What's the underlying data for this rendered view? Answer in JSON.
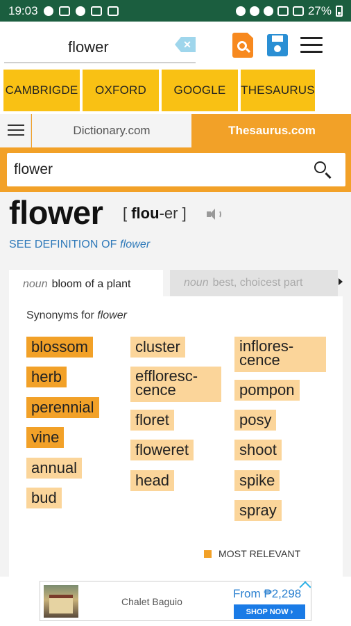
{
  "status_bar": {
    "time": "19:03",
    "battery": "27%"
  },
  "search": {
    "value": "flower"
  },
  "sources": [
    "CAMBRIGDE",
    "OXFORD",
    "GOOGLE",
    "THESAURUS"
  ],
  "site_tabs": {
    "dictionary": "Dictionary.com",
    "thesaurus": "Thesaurus.com"
  },
  "thesaurus_search": {
    "value": "flower"
  },
  "entry": {
    "headword": "flower",
    "pron_open": "[ ",
    "pron_stress": "flou",
    "pron_rest": "-er ]",
    "see_def_prefix": "SEE DEFINITION OF ",
    "see_def_word": "flower"
  },
  "sense_tabs": [
    {
      "pos": "noun",
      "label": "bloom of a plant"
    },
    {
      "pos": "noun",
      "label": "best, choicest part"
    }
  ],
  "synonyms": {
    "heading_prefix": "Synonyms for ",
    "heading_word": "flower",
    "col1": [
      {
        "word": "blossom",
        "relevance": "strong"
      },
      {
        "word": "herb",
        "relevance": "strong"
      },
      {
        "word": "perennial",
        "relevance": "strong"
      },
      {
        "word": "vine",
        "relevance": "strong"
      },
      {
        "word": "annual",
        "relevance": "weak"
      },
      {
        "word": "bud",
        "relevance": "weak"
      }
    ],
    "col2": [
      {
        "word": "cluster",
        "relevance": "weak"
      },
      {
        "word": "effloresence",
        "relevance": "weak",
        "line1": "effloresc-",
        "line2": "cence"
      },
      {
        "word": "floret",
        "relevance": "weak"
      },
      {
        "word": "floweret",
        "relevance": "weak"
      },
      {
        "word": "head",
        "relevance": "weak"
      }
    ],
    "col3": [
      {
        "word": "inflorescence",
        "relevance": "weak",
        "line1": "inflores-",
        "line2": "cence"
      },
      {
        "word": "pompon",
        "relevance": "weak"
      },
      {
        "word": "posy",
        "relevance": "weak"
      },
      {
        "word": "shoot",
        "relevance": "weak"
      },
      {
        "word": "spike",
        "relevance": "weak"
      },
      {
        "word": "spray",
        "relevance": "weak"
      }
    ],
    "legend": "MOST RELEVANT"
  },
  "ad": {
    "title": "Chalet Baguio",
    "price": "From ₱2,298",
    "cta": "SHOP NOW ›"
  },
  "colors": {
    "status_bar": "#1b5e3f",
    "accent_orange": "#f2a128",
    "source_yellow": "#f9c114",
    "chip_strong": "#f2a128",
    "chip_weak": "#fbd59a",
    "link_blue": "#2e79b9"
  }
}
